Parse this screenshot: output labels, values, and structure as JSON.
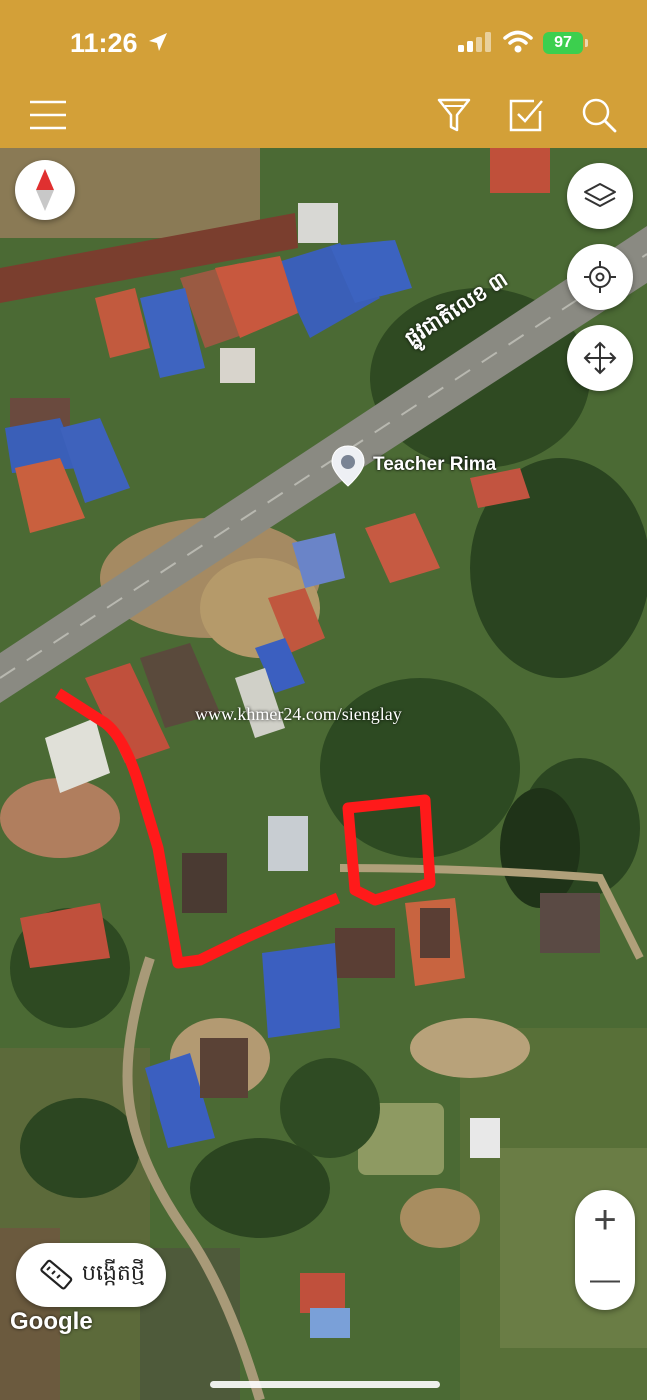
{
  "status_bar": {
    "time": "11:26",
    "battery": "97"
  },
  "toolbar": {
    "menu_icon": "hamburger-menu-icon",
    "filter_icon": "filter-icon",
    "edit_icon": "checkbox-edit-icon",
    "search_icon": "search-icon",
    "color": "#d3a038"
  },
  "map": {
    "road_label": "ផ្លូវជាតិលេខ ៣",
    "marker_label": "Teacher Rima",
    "watermark": "www.khmer24.com/sienglay",
    "attribution": "Google",
    "boundary_color": "#ff1a1a"
  },
  "controls": {
    "layers_icon": "layers-icon",
    "locate_icon": "crosshair-icon",
    "move_icon": "move-arrows-icon",
    "zoom_in": "+",
    "zoom_out": "—",
    "measure_label": "បង្កើតថ្មី",
    "measure_icon": "ruler-icon"
  }
}
